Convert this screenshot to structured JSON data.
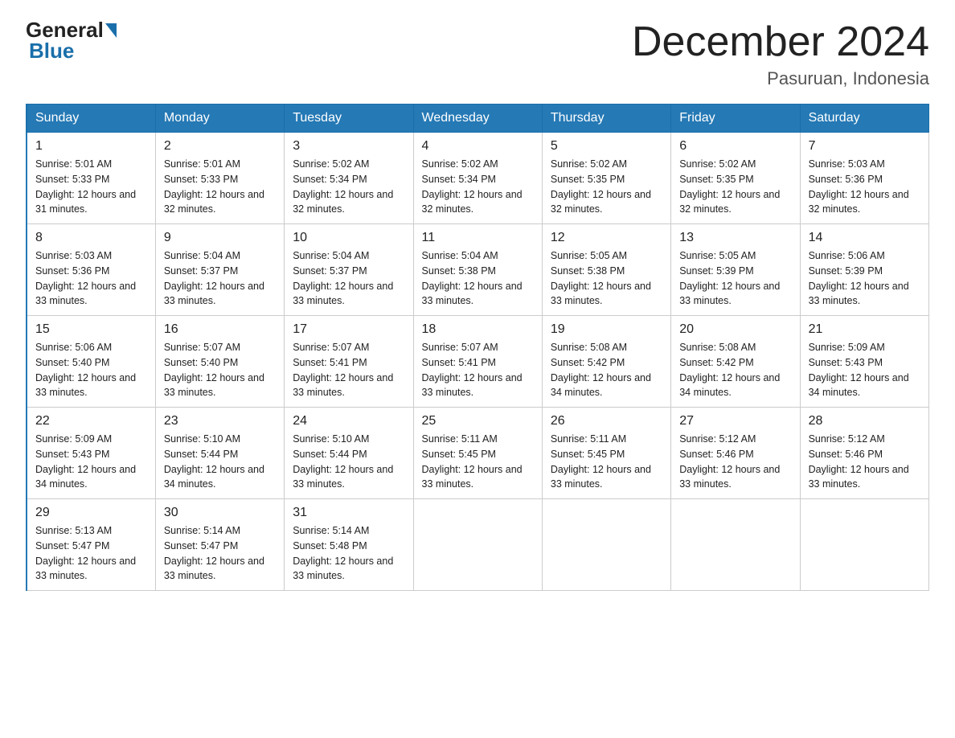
{
  "header": {
    "logo_general": "General",
    "logo_blue": "Blue",
    "month_title": "December 2024",
    "location": "Pasuruan, Indonesia"
  },
  "weekdays": [
    "Sunday",
    "Monday",
    "Tuesday",
    "Wednesday",
    "Thursday",
    "Friday",
    "Saturday"
  ],
  "weeks": [
    [
      {
        "day": "1",
        "sunrise": "5:01 AM",
        "sunset": "5:33 PM",
        "daylight": "12 hours and 31 minutes."
      },
      {
        "day": "2",
        "sunrise": "5:01 AM",
        "sunset": "5:33 PM",
        "daylight": "12 hours and 32 minutes."
      },
      {
        "day": "3",
        "sunrise": "5:02 AM",
        "sunset": "5:34 PM",
        "daylight": "12 hours and 32 minutes."
      },
      {
        "day": "4",
        "sunrise": "5:02 AM",
        "sunset": "5:34 PM",
        "daylight": "12 hours and 32 minutes."
      },
      {
        "day": "5",
        "sunrise": "5:02 AM",
        "sunset": "5:35 PM",
        "daylight": "12 hours and 32 minutes."
      },
      {
        "day": "6",
        "sunrise": "5:02 AM",
        "sunset": "5:35 PM",
        "daylight": "12 hours and 32 minutes."
      },
      {
        "day": "7",
        "sunrise": "5:03 AM",
        "sunset": "5:36 PM",
        "daylight": "12 hours and 32 minutes."
      }
    ],
    [
      {
        "day": "8",
        "sunrise": "5:03 AM",
        "sunset": "5:36 PM",
        "daylight": "12 hours and 33 minutes."
      },
      {
        "day": "9",
        "sunrise": "5:04 AM",
        "sunset": "5:37 PM",
        "daylight": "12 hours and 33 minutes."
      },
      {
        "day": "10",
        "sunrise": "5:04 AM",
        "sunset": "5:37 PM",
        "daylight": "12 hours and 33 minutes."
      },
      {
        "day": "11",
        "sunrise": "5:04 AM",
        "sunset": "5:38 PM",
        "daylight": "12 hours and 33 minutes."
      },
      {
        "day": "12",
        "sunrise": "5:05 AM",
        "sunset": "5:38 PM",
        "daylight": "12 hours and 33 minutes."
      },
      {
        "day": "13",
        "sunrise": "5:05 AM",
        "sunset": "5:39 PM",
        "daylight": "12 hours and 33 minutes."
      },
      {
        "day": "14",
        "sunrise": "5:06 AM",
        "sunset": "5:39 PM",
        "daylight": "12 hours and 33 minutes."
      }
    ],
    [
      {
        "day": "15",
        "sunrise": "5:06 AM",
        "sunset": "5:40 PM",
        "daylight": "12 hours and 33 minutes."
      },
      {
        "day": "16",
        "sunrise": "5:07 AM",
        "sunset": "5:40 PM",
        "daylight": "12 hours and 33 minutes."
      },
      {
        "day": "17",
        "sunrise": "5:07 AM",
        "sunset": "5:41 PM",
        "daylight": "12 hours and 33 minutes."
      },
      {
        "day": "18",
        "sunrise": "5:07 AM",
        "sunset": "5:41 PM",
        "daylight": "12 hours and 33 minutes."
      },
      {
        "day": "19",
        "sunrise": "5:08 AM",
        "sunset": "5:42 PM",
        "daylight": "12 hours and 34 minutes."
      },
      {
        "day": "20",
        "sunrise": "5:08 AM",
        "sunset": "5:42 PM",
        "daylight": "12 hours and 34 minutes."
      },
      {
        "day": "21",
        "sunrise": "5:09 AM",
        "sunset": "5:43 PM",
        "daylight": "12 hours and 34 minutes."
      }
    ],
    [
      {
        "day": "22",
        "sunrise": "5:09 AM",
        "sunset": "5:43 PM",
        "daylight": "12 hours and 34 minutes."
      },
      {
        "day": "23",
        "sunrise": "5:10 AM",
        "sunset": "5:44 PM",
        "daylight": "12 hours and 34 minutes."
      },
      {
        "day": "24",
        "sunrise": "5:10 AM",
        "sunset": "5:44 PM",
        "daylight": "12 hours and 33 minutes."
      },
      {
        "day": "25",
        "sunrise": "5:11 AM",
        "sunset": "5:45 PM",
        "daylight": "12 hours and 33 minutes."
      },
      {
        "day": "26",
        "sunrise": "5:11 AM",
        "sunset": "5:45 PM",
        "daylight": "12 hours and 33 minutes."
      },
      {
        "day": "27",
        "sunrise": "5:12 AM",
        "sunset": "5:46 PM",
        "daylight": "12 hours and 33 minutes."
      },
      {
        "day": "28",
        "sunrise": "5:12 AM",
        "sunset": "5:46 PM",
        "daylight": "12 hours and 33 minutes."
      }
    ],
    [
      {
        "day": "29",
        "sunrise": "5:13 AM",
        "sunset": "5:47 PM",
        "daylight": "12 hours and 33 minutes."
      },
      {
        "day": "30",
        "sunrise": "5:14 AM",
        "sunset": "5:47 PM",
        "daylight": "12 hours and 33 minutes."
      },
      {
        "day": "31",
        "sunrise": "5:14 AM",
        "sunset": "5:48 PM",
        "daylight": "12 hours and 33 minutes."
      },
      null,
      null,
      null,
      null
    ]
  ]
}
